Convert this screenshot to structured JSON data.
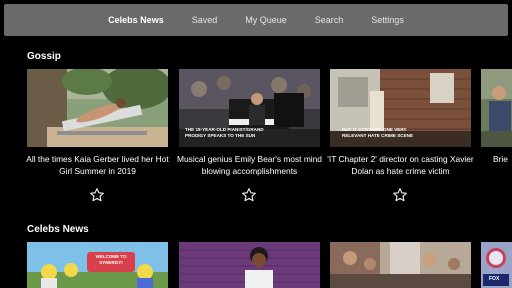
{
  "nav": {
    "items": [
      {
        "label": "Celebs News",
        "active": true
      },
      {
        "label": "Saved"
      },
      {
        "label": "My Queue"
      },
      {
        "label": "Search"
      },
      {
        "label": "Settings"
      }
    ]
  },
  "sections": {
    "gossip": {
      "title": "Gossip",
      "cards": [
        {
          "caption": "All the times Kaia Gerber lived her Hot Girl Summer in 2019"
        },
        {
          "caption": "Musical genius Emily Bear's most mind blowing accomplishments",
          "overlay_top": "THE 18-YEAR-OLD PIANIST/GRAND",
          "overlay_bottom": "PRODIGY SPEAKS TO THE SUN"
        },
        {
          "caption": "'IT Chapter 2' director on casting Xavier Dolan as hate crime victim",
          "overlay_top": "BUT IT CONTAINS ONE VERY",
          "overlay_bottom": "RELEVANT HATE CRIME SCENE"
        },
        {
          "caption": "Brie"
        }
      ]
    },
    "celebs_news": {
      "title": "Celebs News",
      "thumb_text": [
        "WELCOME TO",
        "SYNERGY!",
        "FOX"
      ]
    }
  },
  "icons": {
    "star": "star-outline-icon"
  },
  "colors": {
    "background": "#000000",
    "navbar": "#6a6a6a",
    "text": "#ffffff"
  }
}
